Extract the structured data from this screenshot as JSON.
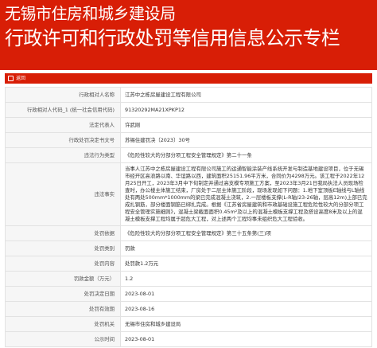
{
  "header": {
    "line1": "无锡市住房和城乡建设局",
    "line2": "行政许可和行政处罚等信用信息公示专栏"
  },
  "crumb": {
    "label": "返回"
  },
  "rows": [
    {
      "key": "行政相对人名称",
      "value": "江苏中之栋房屋建设工程有限公司"
    },
    {
      "key": "行政相对人代码_1 (统一社会信用代码)",
      "value": "91320292MA21XPKP12"
    },
    {
      "key": "法定代表人",
      "value": "许武刚"
    },
    {
      "key": "行政处罚决定书文号",
      "value": "苏锡住建罚决〔2023〕30号"
    },
    {
      "key": "违法行为类型",
      "value": "《危险性较大的分部分项工程安全管理规定》第二十一条"
    },
    {
      "key": "违法事实",
      "value": "当事人江苏中之栋房屋建设工程有限公司施工的运通智能涂装产线系统开发与制造基地建设项目，位于无锡市经开区高浪路以南、华谊路以西，建筑面积25151.96平方米，合同价为4298万元。该工程于2022年12月25日开工，2023年3月中下旬制定并通过高支模专项施工方案，至2023年3月21日我局执法人员现场检查时，办公楼主体施工结束，厂房处于二层主体施工阶段，现场发现如下问题：1.地下室顶板E轴线与L轴线处有两处500mm*1000mm的梁已完成混凝土浇筑，2.一层楼板支撑(L-R轴/23-26轴，层高12m)上部已完成扎钢筋，部分楼面钢筋已绑扎完成。根据《江苏省房屋建筑和市政基础设施工程危险性较大的分部分项工程安全管理实施细则》，混凝土梁截面面积0.45m²及以上的混凝土模板支撑工程及搭设高度8米及以上的混凝土模板支撑工程均属于超危大工程，对上述两个工程均事未组织危大工程验收。"
    },
    {
      "key": "处罚依据",
      "value": "《危险性较大的分部分项工程安全管理规定》第三十五条第(三)项"
    },
    {
      "key": "处罚类别",
      "value": "罚款"
    },
    {
      "key": "处罚内容",
      "value": "处罚款1.2万元"
    },
    {
      "key": "罚款金额（万元）",
      "value": "1.2"
    },
    {
      "key": "处罚决定日期",
      "value": "2023-08-01"
    },
    {
      "key": "处罚有效期",
      "value": "2023-08-16"
    },
    {
      "key": "处罚机关",
      "value": "无锡市住房和城乡建设局"
    },
    {
      "key": "公示时间",
      "value": "2023-08-01"
    }
  ]
}
